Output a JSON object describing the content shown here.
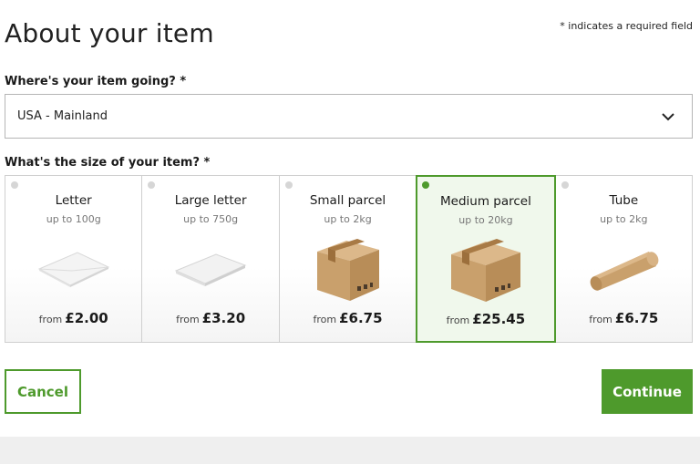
{
  "page": {
    "title": "About your item",
    "required_note": "* indicates a required field"
  },
  "destination": {
    "label": "Where's your item going? *",
    "value": "USA - Mainland"
  },
  "size": {
    "label": "What's the size of your item? *",
    "options": [
      {
        "name": "Letter",
        "weight": "up to 100g",
        "price_prefix": "from",
        "price": "£2.00",
        "icon": "envelope-icon",
        "selected": false
      },
      {
        "name": "Large letter",
        "weight": "up to 750g",
        "price_prefix": "from",
        "price": "£3.20",
        "icon": "large-letter-icon",
        "selected": false
      },
      {
        "name": "Small parcel",
        "weight": "up to 2kg",
        "price_prefix": "from",
        "price": "£6.75",
        "icon": "parcel-box-icon",
        "selected": false
      },
      {
        "name": "Medium parcel",
        "weight": "up to 20kg",
        "price_prefix": "from",
        "price": "£25.45",
        "icon": "parcel-box-icon",
        "selected": true
      },
      {
        "name": "Tube",
        "weight": "up to 2kg",
        "price_prefix": "from",
        "price": "£6.75",
        "icon": "tube-icon",
        "selected": false
      }
    ]
  },
  "actions": {
    "cancel_label": "Cancel",
    "continue_label": "Continue"
  },
  "colors": {
    "accent": "#4e9a2c",
    "selected_bg": "#f0f8ec",
    "cardboard": "#c9a06c"
  }
}
